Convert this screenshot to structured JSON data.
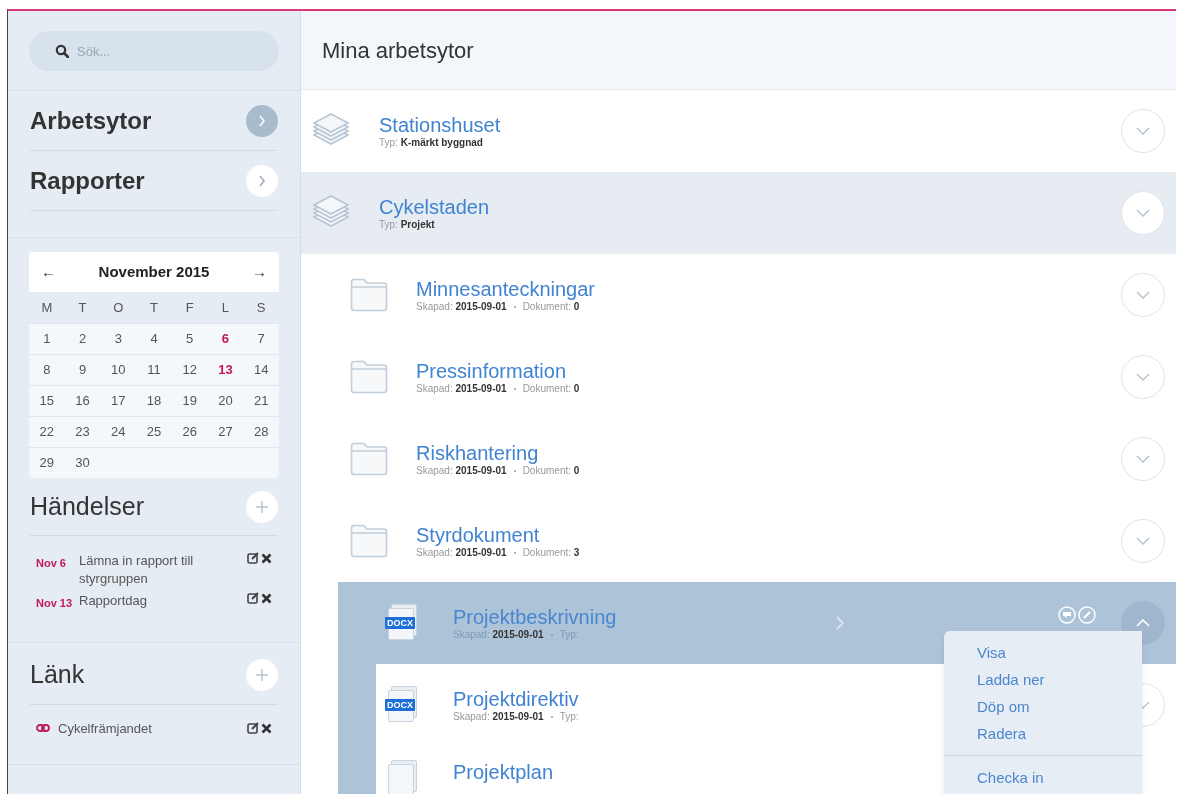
{
  "sidebar": {
    "search": {
      "placeholder": "Sök..."
    },
    "nav": [
      {
        "label": "Arbetsytor",
        "selected": true
      },
      {
        "label": "Rapporter",
        "selected": false
      }
    ],
    "calendar": {
      "prev": "←",
      "month": "November 2015",
      "next": "→",
      "weekdays": [
        "M",
        "T",
        "O",
        "T",
        "F",
        "L",
        "S"
      ],
      "weeks": [
        [
          {
            "day": "1",
            "event": false
          },
          {
            "day": "2",
            "event": false
          },
          {
            "day": "3",
            "event": false
          },
          {
            "day": "4",
            "event": false
          },
          {
            "day": "5",
            "event": false
          },
          {
            "day": "6",
            "event": true
          },
          {
            "day": "7",
            "event": false
          }
        ],
        [
          {
            "day": "8",
            "event": false
          },
          {
            "day": "9",
            "event": false
          },
          {
            "day": "10",
            "event": false
          },
          {
            "day": "11",
            "event": false
          },
          {
            "day": "12",
            "event": false
          },
          {
            "day": "13",
            "event": true
          },
          {
            "day": "14",
            "event": false
          }
        ],
        [
          {
            "day": "15",
            "event": false
          },
          {
            "day": "16",
            "event": false
          },
          {
            "day": "17",
            "event": false
          },
          {
            "day": "18",
            "event": false
          },
          {
            "day": "19",
            "event": false
          },
          {
            "day": "20",
            "event": false
          },
          {
            "day": "21",
            "event": false
          }
        ],
        [
          {
            "day": "22",
            "event": false
          },
          {
            "day": "23",
            "event": false
          },
          {
            "day": "24",
            "event": false
          },
          {
            "day": "25",
            "event": false
          },
          {
            "day": "26",
            "event": false
          },
          {
            "day": "27",
            "event": false
          },
          {
            "day": "28",
            "event": false
          }
        ],
        [
          {
            "day": "29",
            "event": false
          },
          {
            "day": "30",
            "event": false
          }
        ]
      ]
    },
    "events": {
      "title": "Händelser",
      "items": [
        {
          "date": "Nov 6",
          "text": "Lämna in rapport till styrgruppen"
        },
        {
          "date": "Nov 13",
          "text": "Rapportdag"
        }
      ]
    },
    "links": {
      "title": "Länk",
      "items": [
        {
          "text": "Cykelfrämjandet"
        }
      ]
    }
  },
  "main": {
    "title": "Mina arbetsytor",
    "items": [
      {
        "kind": "workspace",
        "title": "Stationshuset",
        "meta": [
          {
            "label": "Typ:",
            "value": "K-märkt byggnad"
          }
        ],
        "expanded": false
      },
      {
        "kind": "workspace",
        "title": "Cykelstaden",
        "meta": [
          {
            "label": "Typ:",
            "value": "Projekt"
          }
        ],
        "expanded": true,
        "children": [
          {
            "kind": "folder",
            "title": "Minnesanteckningar",
            "meta": [
              {
                "label": "Skapad:",
                "value": "2015-09-01"
              },
              {
                "label": "Dokument:",
                "value": "0"
              }
            ],
            "expanded": false
          },
          {
            "kind": "folder",
            "title": "Pressinformation",
            "meta": [
              {
                "label": "Skapad:",
                "value": "2015-09-01"
              },
              {
                "label": "Dokument:",
                "value": "0"
              }
            ],
            "expanded": false
          },
          {
            "kind": "folder",
            "title": "Riskhantering",
            "meta": [
              {
                "label": "Skapad:",
                "value": "2015-09-01"
              },
              {
                "label": "Dokument:",
                "value": "0"
              }
            ],
            "expanded": false
          },
          {
            "kind": "folder",
            "title": "Styrdokument",
            "meta": [
              {
                "label": "Skapad:",
                "value": "2015-09-01"
              },
              {
                "label": "Dokument:",
                "value": "3"
              }
            ],
            "expanded": true,
            "children": [
              {
                "kind": "document",
                "file_type": "DOCX",
                "title": "Projektbeskrivning",
                "meta": [
                  {
                    "label": "Skapad:",
                    "value": "2015-09-01"
                  },
                  {
                    "label": "Typ:"
                  }
                ],
                "selected": true
              },
              {
                "kind": "document",
                "file_type": "DOCX",
                "title": "Projektdirektiv",
                "meta": [
                  {
                    "label": "Skapad:",
                    "value": "2015-09-01"
                  },
                  {
                    "label": "Typ:"
                  }
                ],
                "selected": false
              },
              {
                "kind": "document",
                "title": "Projektplan",
                "selected": false
              }
            ]
          }
        ]
      }
    ],
    "menu": [
      [
        "Visa",
        "Ladda ner",
        "Döp om",
        "Radera"
      ],
      [
        "Checka in"
      ]
    ]
  }
}
